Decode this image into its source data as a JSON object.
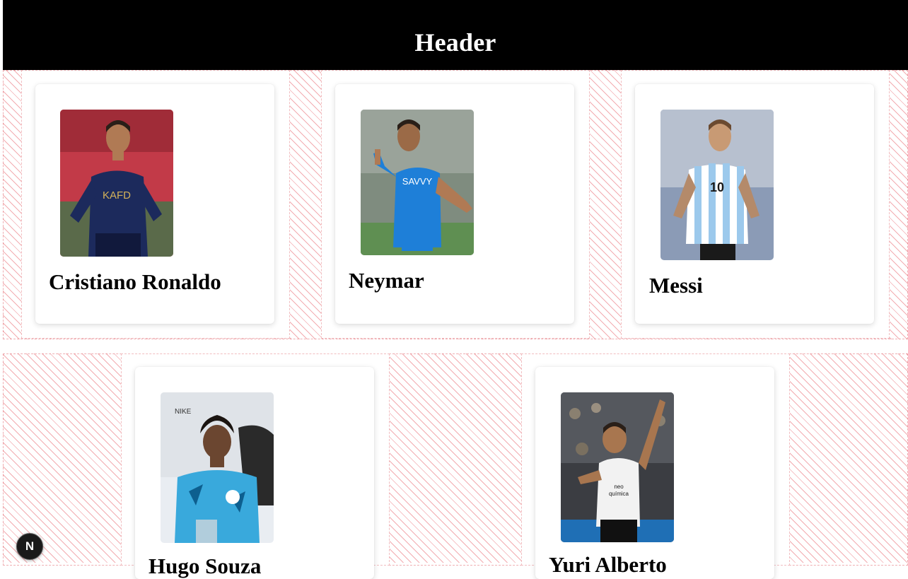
{
  "header": {
    "title": "Header"
  },
  "players": [
    {
      "name": "Cristiano Ronaldo",
      "photo_icon": "player-photo-ronaldo",
      "kit": "#1c2a5c",
      "kit_accent": "#d4b25a",
      "bg": "#c23a48"
    },
    {
      "name": "Neymar",
      "photo_icon": "player-photo-neymar",
      "kit": "#1e7fd8",
      "kit_accent": "#ffffff",
      "bg": "#6e8a64"
    },
    {
      "name": "Messi",
      "photo_icon": "player-photo-messi",
      "kit": "#9cc9ec",
      "kit_accent": "#ffffff",
      "bg": "#8b9bb6"
    },
    {
      "name": "Hugo Souza",
      "photo_icon": "player-photo-hugo",
      "kit": "#39a9dc",
      "kit_accent": "#0d5f8f",
      "bg": "#e9edf2"
    },
    {
      "name": "Yuri Alberto",
      "photo_icon": "player-photo-yuri",
      "kit": "#f2f2f2",
      "kit_accent": "#1a1a1a",
      "bg": "#3b3d42"
    }
  ],
  "dev_badge": {
    "label": "N",
    "icon": "nextjs-dev-indicator-icon"
  },
  "colors": {
    "header_bg": "#000000",
    "header_text": "#ffffff",
    "hatch": "#e86870"
  }
}
